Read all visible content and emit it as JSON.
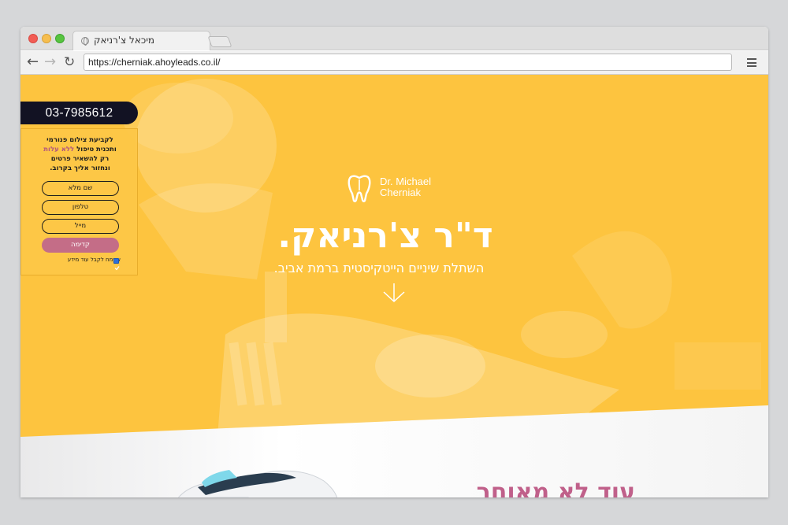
{
  "browser": {
    "tab_title": "מיכאל צ'רניאק",
    "url": "https://cherniak.ahoyleads.co.il/"
  },
  "contact": {
    "phone": "03-7985612"
  },
  "lead_form": {
    "line1": "לקביעת צילום פנורמי",
    "line2_prefix": "ותכנית טיפול ",
    "line2_accent": "ללא עלות",
    "line3": "רק להשאיר פרטים",
    "line4": "ונחזור אליך בקרוב.",
    "name_placeholder": "שם מלא",
    "phone_placeholder": "טלפון",
    "email_placeholder": "מייל",
    "submit_label": "קדימה",
    "consent_label": "אשמח לקבל עוד מידע",
    "consent_checked": true
  },
  "hero": {
    "logo_line1": "Dr. Michael",
    "logo_line2": "Cherniak",
    "title": "ד\"ר צ'רניאק.",
    "subtitle": "השתלת שיניים הייטקיסטית ברמת אביב."
  },
  "section2": {
    "title": "עוד לא מאוחר"
  },
  "colors": {
    "hero_yellow": "#fdc43f",
    "dark_navy": "#121223",
    "accent_pink": "#c46d87",
    "section_title_pink": "#c0608a"
  },
  "icons": {
    "logo": "tooth-icon",
    "scroll": "arrow-down-icon",
    "menu": "hamburger-menu-icon"
  }
}
